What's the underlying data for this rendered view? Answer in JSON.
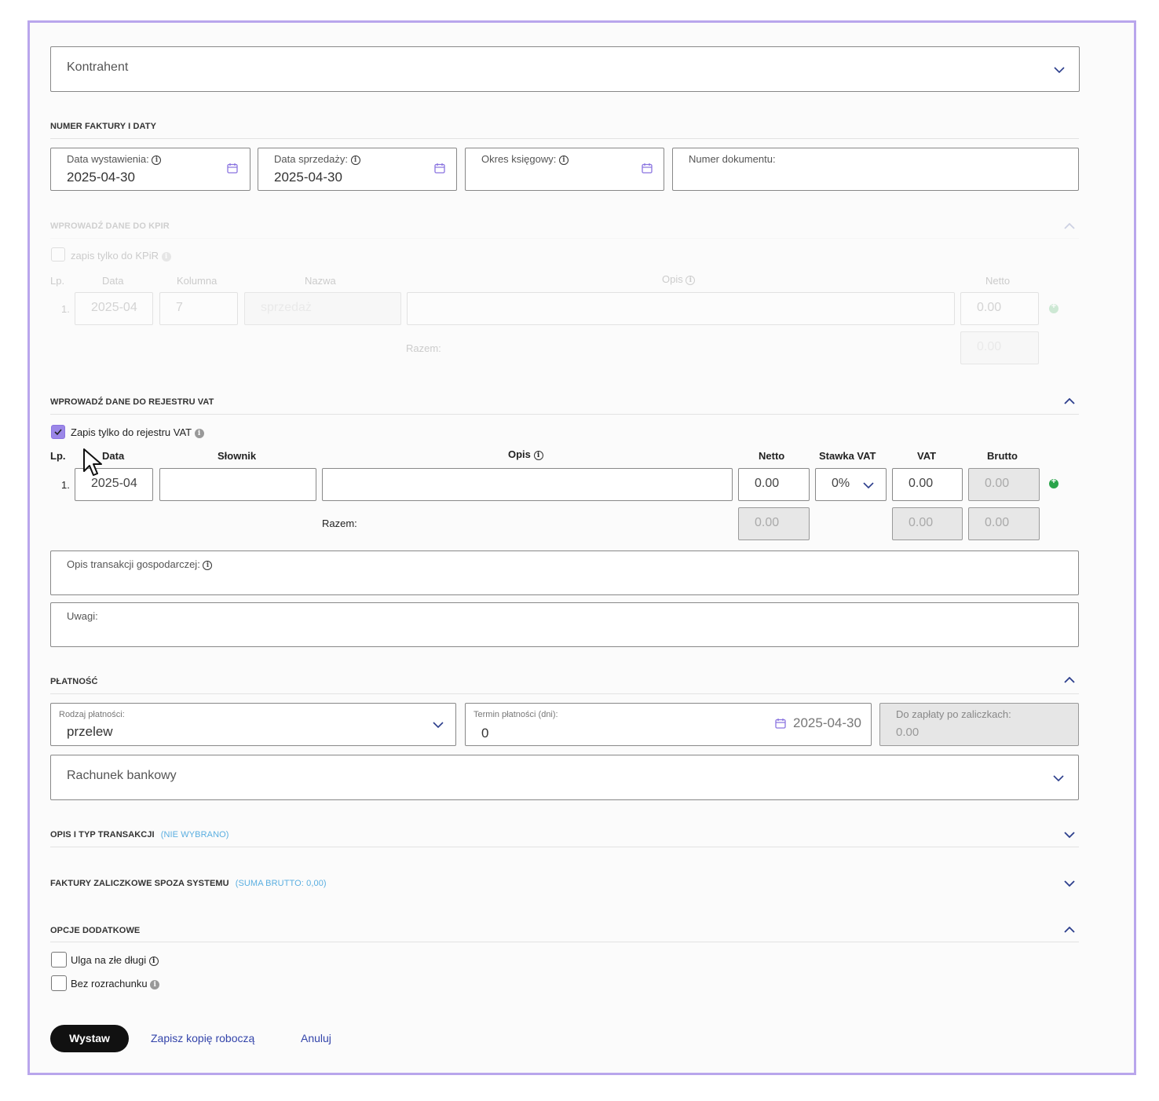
{
  "kontrahent": {
    "placeholder": "Kontrahent"
  },
  "invoice_dates": {
    "section_title": "NUMER FAKTURY I DATY",
    "issue_date_label": "Data wystawienia:",
    "issue_date_value": "2025-04-30",
    "sale_date_label": "Data sprzedaży:",
    "sale_date_value": "2025-04-30",
    "period_label": "Okres księgowy:",
    "doc_number_label": "Numer dokumentu:"
  },
  "kpir": {
    "section_title": "WPROWADŹ DANE DO KPIR",
    "checkbox_label": "zapis tylko do KPiR",
    "headers": [
      "Lp.",
      "Data",
      "Kolumna",
      "Nazwa",
      "Opis",
      "Netto"
    ],
    "row": {
      "lp": "1.",
      "date": "2025-04",
      "column": "7",
      "name": "sprzedaż",
      "netto": "0.00"
    },
    "total_label": "Razem:",
    "total_value": "0.00"
  },
  "vat": {
    "section_title": "WPROWADŹ DANE DO REJESTRU VAT",
    "checkbox_label": "Zapis tylko do rejestru VAT",
    "headers": {
      "lp": "Lp.",
      "data": "Data",
      "slownik": "Słownik",
      "opis": "Opis",
      "netto": "Netto",
      "stawka": "Stawka VAT",
      "vat": "VAT",
      "brutto": "Brutto"
    },
    "row": {
      "lp": "1.",
      "date": "2025-04",
      "netto": "0.00",
      "stawka": "0%",
      "vat": "0.00",
      "brutto": "0.00"
    },
    "total_label": "Razem:",
    "totals": {
      "netto": "0.00",
      "vat": "0.00",
      "brutto": "0.00"
    }
  },
  "transaction_desc_label": "Opis transakcji gospodarczej:",
  "notes_label": "Uwagi:",
  "payment": {
    "section_title": "PŁATNOŚĆ",
    "method_label": "Rodzaj płatności:",
    "method_value": "przelew",
    "term_label": "Termin płatności (dni):",
    "term_value": "0",
    "term_date": "2025-04-30",
    "due_label": "Do zapłaty po zaliczkach:",
    "due_value": "0.00",
    "bank_placeholder": "Rachunek bankowy"
  },
  "transaction_type": {
    "title": "OPIS I TYP TRANSAKCJI",
    "badge": "(NIE WYBRANO)"
  },
  "advance_invoices": {
    "title": "FAKTURY ZALICZKOWE SPOZA SYSTEMU",
    "badge": "(SUMA BRUTTO: 0,00)"
  },
  "extra_options": {
    "title": "OPCJE DODATKOWE",
    "bad_debt_label": "Ulga na złe długi",
    "no_settlement_label": "Bez rozrachunku"
  },
  "actions": {
    "issue": "Wystaw",
    "save_draft": "Zapisz kopię roboczą",
    "cancel": "Anuluj"
  },
  "colors": {
    "accent": "#9b87e8",
    "frame": "#b9a6ec",
    "link": "#3344aa",
    "badge": "#5aaee0"
  }
}
